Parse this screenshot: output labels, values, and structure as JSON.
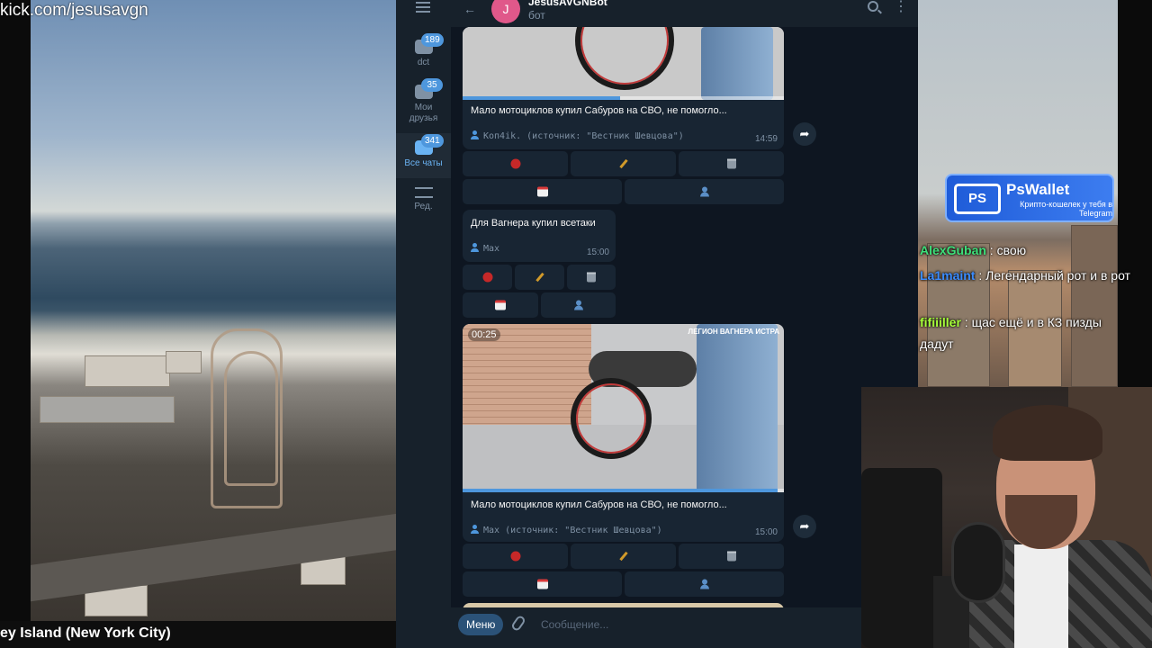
{
  "stream": {
    "url": "kick.com/jesusavgn",
    "bottom_title": "ey Island (New York City)"
  },
  "telegram": {
    "folders": [
      {
        "label": "dct",
        "badge": "189"
      },
      {
        "label": "Мои друзья",
        "badge": "35"
      },
      {
        "label": "Все чаты",
        "badge": "341"
      },
      {
        "label": "Ред.",
        "badge": ""
      }
    ],
    "header": {
      "avatar_letter": "J",
      "name": "JesusAVGNBot",
      "status": "бот"
    },
    "messages": [
      {
        "text": "Мало мотоциклов купил Сабуров на СВО, не помогло...",
        "signature": "Коп4ik. (источник: \"Вестник Шевцова\")",
        "time": "14:59",
        "progress": 0.49
      },
      {
        "text": "Для Вагнера купил всетаки",
        "signature": "Max",
        "time": "15:00"
      },
      {
        "video_duration": "00:25",
        "watermark": "ЛЕГИОН ВАГНЕРА ИСТРА",
        "text": "Мало мотоциклов купил Сабуров на СВО, не помогло...",
        "signature": "Max (источник: \"Вестник Шевцова\")",
        "time": "15:00",
        "progress": 0.98
      }
    ],
    "input": {
      "menu_label": "Меню",
      "placeholder": "Сообщение..."
    }
  },
  "ad": {
    "logo": "PS",
    "title": "PsWallet",
    "subtitle": "Крипто-кошелек у тебя в Telegram"
  },
  "chat": [
    {
      "user": "AlexGuban",
      "user_color": "#3ee07a",
      "text": ": свою"
    },
    {
      "user": "La1maint",
      "user_color": "#3b8cff",
      "text": ": Легендарный рот и в рот"
    },
    {
      "user": "fifiiiller",
      "user_color": "#a6ff3a",
      "text": ": щас ещё и в КЗ пизды дадут"
    }
  ],
  "colors": {
    "accent": "#4e97dd",
    "bubble": "#182533",
    "background": "#0e1621"
  }
}
